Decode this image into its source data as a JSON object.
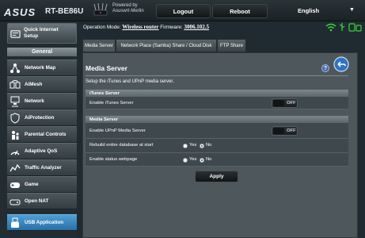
{
  "header": {
    "brand": "ASUS",
    "model": "RT-BE86U",
    "powered_line1": "Powered by",
    "powered_line2": "Asuswrt-Merlin",
    "logout": "Logout",
    "reboot": "Reboot",
    "language": "English"
  },
  "sidebar": {
    "qis_line1": "Quick Internet",
    "qis_line2": "Setup",
    "general": "General",
    "items": [
      {
        "label": "Network Map",
        "icon": "network-map-icon"
      },
      {
        "label": "AiMesh",
        "icon": "aimesh-icon"
      },
      {
        "label": "Network",
        "icon": "network-icon"
      },
      {
        "label": "AiProtection",
        "icon": "aiprotection-icon"
      },
      {
        "label": "Parental Controls",
        "icon": "parental-controls-icon"
      },
      {
        "label": "Adaptive QoS",
        "icon": "adaptive-qos-icon"
      },
      {
        "label": "Traffic Analyzer",
        "icon": "traffic-analyzer-icon"
      },
      {
        "label": "Game",
        "icon": "game-icon"
      },
      {
        "label": "Open NAT",
        "icon": "open-nat-icon"
      },
      {
        "label": "USB Application",
        "icon": "usb-application-icon"
      }
    ]
  },
  "status": {
    "operation_mode_label": "Operation Mode:",
    "operation_mode_value": "Wireless router",
    "firmware_label": "Firmware:",
    "firmware_value": "3006.102.5"
  },
  "tabs": [
    "Media Server",
    "Network Place (Samba) Share / Cloud Disk",
    "FTP Share"
  ],
  "panel": {
    "title": "Media Server",
    "help": "?",
    "description": "Setup the iTunes and UPnP media server.",
    "itunes_section": "iTunes Server",
    "enable_itunes": "Enable iTunes Server",
    "media_section": "Media Server",
    "enable_upnp": "Enable UPnP Media Server",
    "rebuild_db": "Rebuild entire database at start",
    "status_page": "Enable status webpage",
    "off": "OFF",
    "yes": "Yes",
    "no": "No",
    "apply": "Apply"
  },
  "colors": {
    "active_nav": "#3f8cc6",
    "header_bg": "#1b2225",
    "panel_bg": "#4e585c",
    "wifi_green": "#3ad23a"
  }
}
